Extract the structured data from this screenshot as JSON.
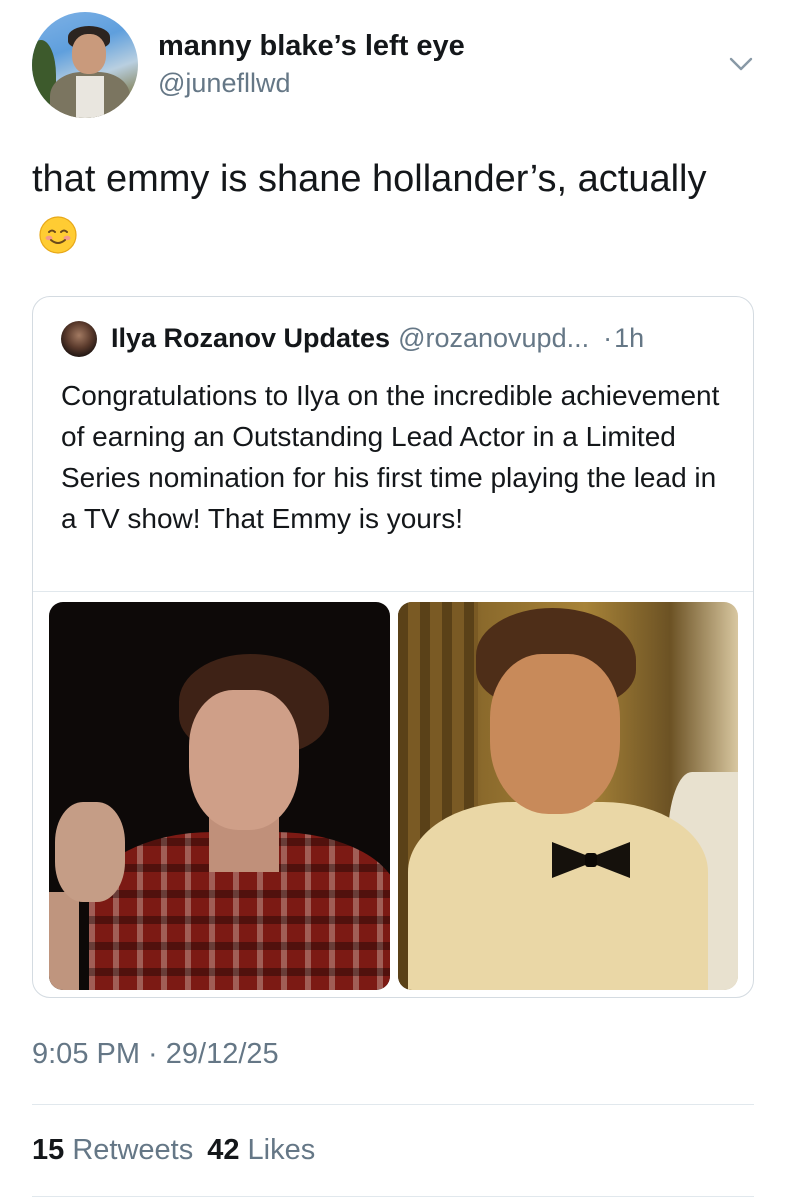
{
  "author": {
    "display_name": "manny blake’s left eye",
    "handle": "@junefllwd"
  },
  "tweet": {
    "text": "that emmy is shane hollander’s, actually",
    "emoji": "smiling-face-icon"
  },
  "quoted_tweet": {
    "display_name": "Ilya Rozanov Updates",
    "handle": "@rozanovupd...",
    "separator": "·",
    "time": "1h",
    "text": "Congratulations to Ilya on the incredible achievement of earning an Outstanding Lead Actor in a Limited Series nomination for his first time playing the lead in a TV show! That Emmy is yours!"
  },
  "meta": {
    "timestamp": "9:05 PM · 29/12/25",
    "retweets_count": "15",
    "retweets_label": "Retweets",
    "likes_count": "42",
    "likes_label": "Likes"
  },
  "icons": {
    "more": "chevron-down-icon"
  }
}
